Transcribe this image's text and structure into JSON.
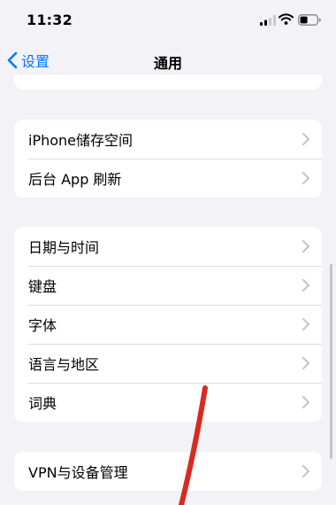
{
  "status_bar": {
    "time": "11:32"
  },
  "nav": {
    "back_label": "设置",
    "title": "通用"
  },
  "groups": [
    {
      "items": [
        {
          "label": "iPhone储存空间"
        },
        {
          "label": "后台 App 刷新"
        }
      ]
    },
    {
      "items": [
        {
          "label": "日期与时间"
        },
        {
          "label": "键盘"
        },
        {
          "label": "字体"
        },
        {
          "label": "语言与地区"
        },
        {
          "label": "词典"
        }
      ]
    },
    {
      "items": [
        {
          "label": "VPN与设备管理"
        }
      ]
    }
  ],
  "colors": {
    "accent": "#007aff",
    "background": "#f2f2f7",
    "annotation": "#d92a1f"
  },
  "icons": [
    "signal-icon",
    "wifi-icon",
    "battery-icon",
    "back-chevron-icon",
    "chevron-right-icon"
  ]
}
